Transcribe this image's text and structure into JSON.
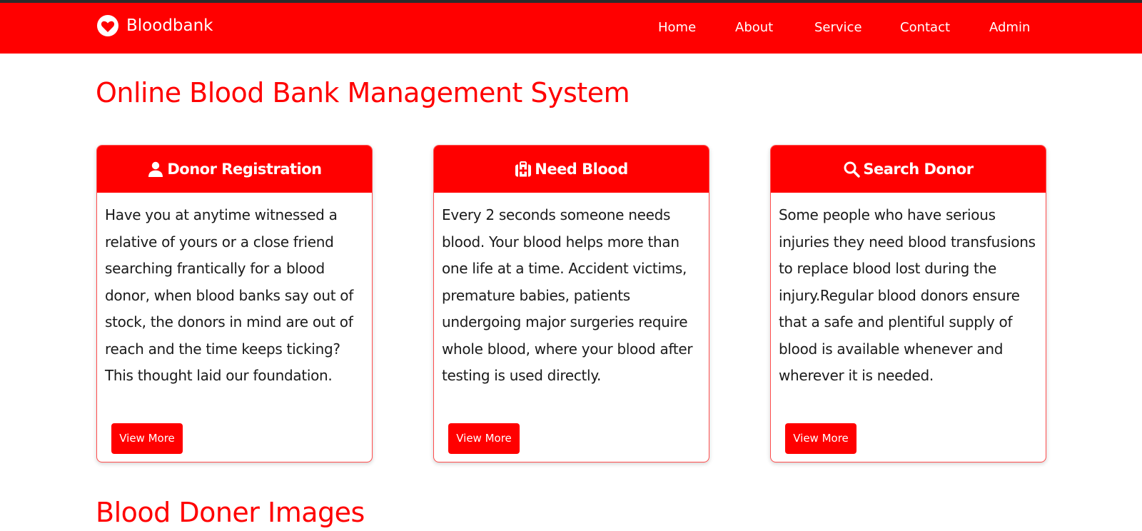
{
  "brand": {
    "name": "Bloodbank",
    "icon": "heart-circle-icon"
  },
  "nav": {
    "items": [
      {
        "label": "Home"
      },
      {
        "label": "About"
      },
      {
        "label": "Service"
      },
      {
        "label": "Contact"
      },
      {
        "label": "Admin"
      }
    ]
  },
  "main": {
    "title": "Online Blood Bank Management System",
    "cards": [
      {
        "icon": "user-icon",
        "title": "Donor Registration",
        "text": "Have you at anytime witnessed a relative of yours or a close friend searching frantically for a blood donor, when blood banks say out of stock, the donors in mind are out of reach and the time keeps ticking?This thought laid our foundation.",
        "button": "View More"
      },
      {
        "icon": "medkit-icon",
        "title": "Need Blood",
        "text": "Every 2 seconds someone needs blood. Your blood helps more than one life at a time. Accident victims, premature babies, patients undergoing major surgeries require whole blood, where your blood after testing is used directly.",
        "button": "View More"
      },
      {
        "icon": "search-icon",
        "title": "Search Donor",
        "text": "Some people who have serious injuries they need blood transfusions to replace blood lost during the injury.Regular blood donors ensure that a safe and plentiful supply of blood is available whenever and wherever it is needed.",
        "button": "View More"
      }
    ],
    "section_title": "Blood Doner Images"
  },
  "colors": {
    "primary": "#ff0000",
    "top_strip": "#2b2b2b",
    "text": "#1a1a1a"
  }
}
